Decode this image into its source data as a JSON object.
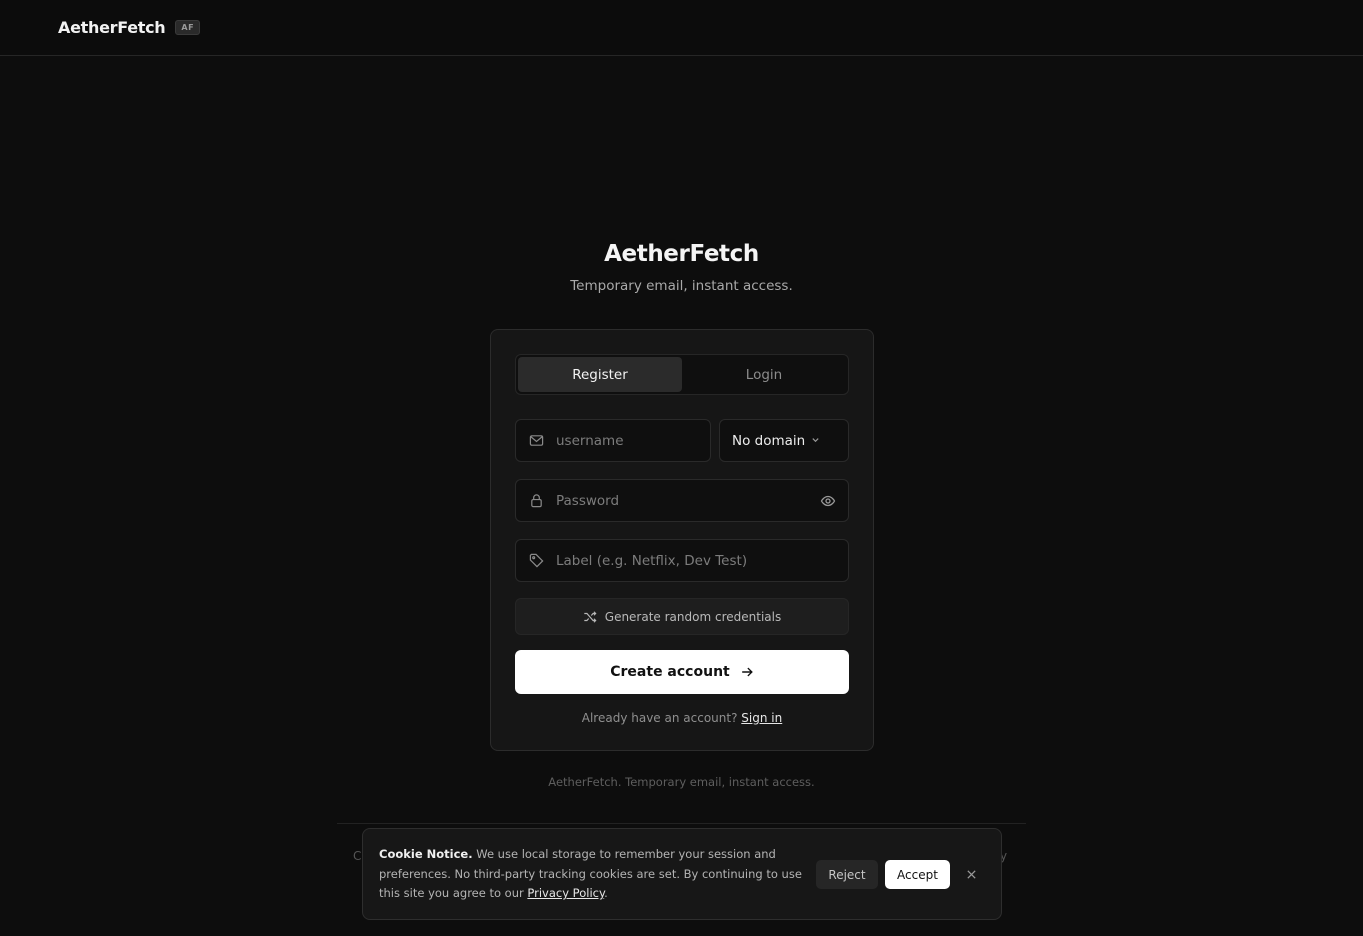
{
  "header": {
    "brand": "AetherFetch",
    "badge": "AF"
  },
  "hero": {
    "title": "AetherFetch",
    "subtitle": "Temporary email, instant access."
  },
  "auth": {
    "tabs": [
      {
        "label": "Register",
        "active": true
      },
      {
        "label": "Login",
        "active": false
      }
    ],
    "username": {
      "placeholder": "username",
      "icon": "mail-icon"
    },
    "domain_select": {
      "value": "No domain",
      "icon": "chevron-down-icon"
    },
    "password": {
      "placeholder": "Password",
      "icon": "lock-icon",
      "toggle_icon": "eye-icon"
    },
    "label_field": {
      "placeholder": "Label (e.g. Netflix, Dev Test)",
      "icon": "tag-icon"
    },
    "generate_label": "Generate random credentials",
    "create_label": "Create account",
    "signin_prompt": "Already have an account?",
    "signin_link": "Sign in"
  },
  "footer": {
    "tagline": "AetherFetch. Temporary email, instant access.",
    "edge_left": "C",
    "edge_right": "y"
  },
  "cookie": {
    "title": "Cookie Notice.",
    "body": "We use local storage to remember your session and preferences. No third-party tracking cookies are set. By continuing to use this site you agree to our",
    "link": "Privacy Policy",
    "after_link": ".",
    "reject_label": "Reject",
    "accept_label": "Accept"
  },
  "colors": {
    "background": "#0d0d0d",
    "card": "#161616",
    "accent": "#ffffff"
  }
}
